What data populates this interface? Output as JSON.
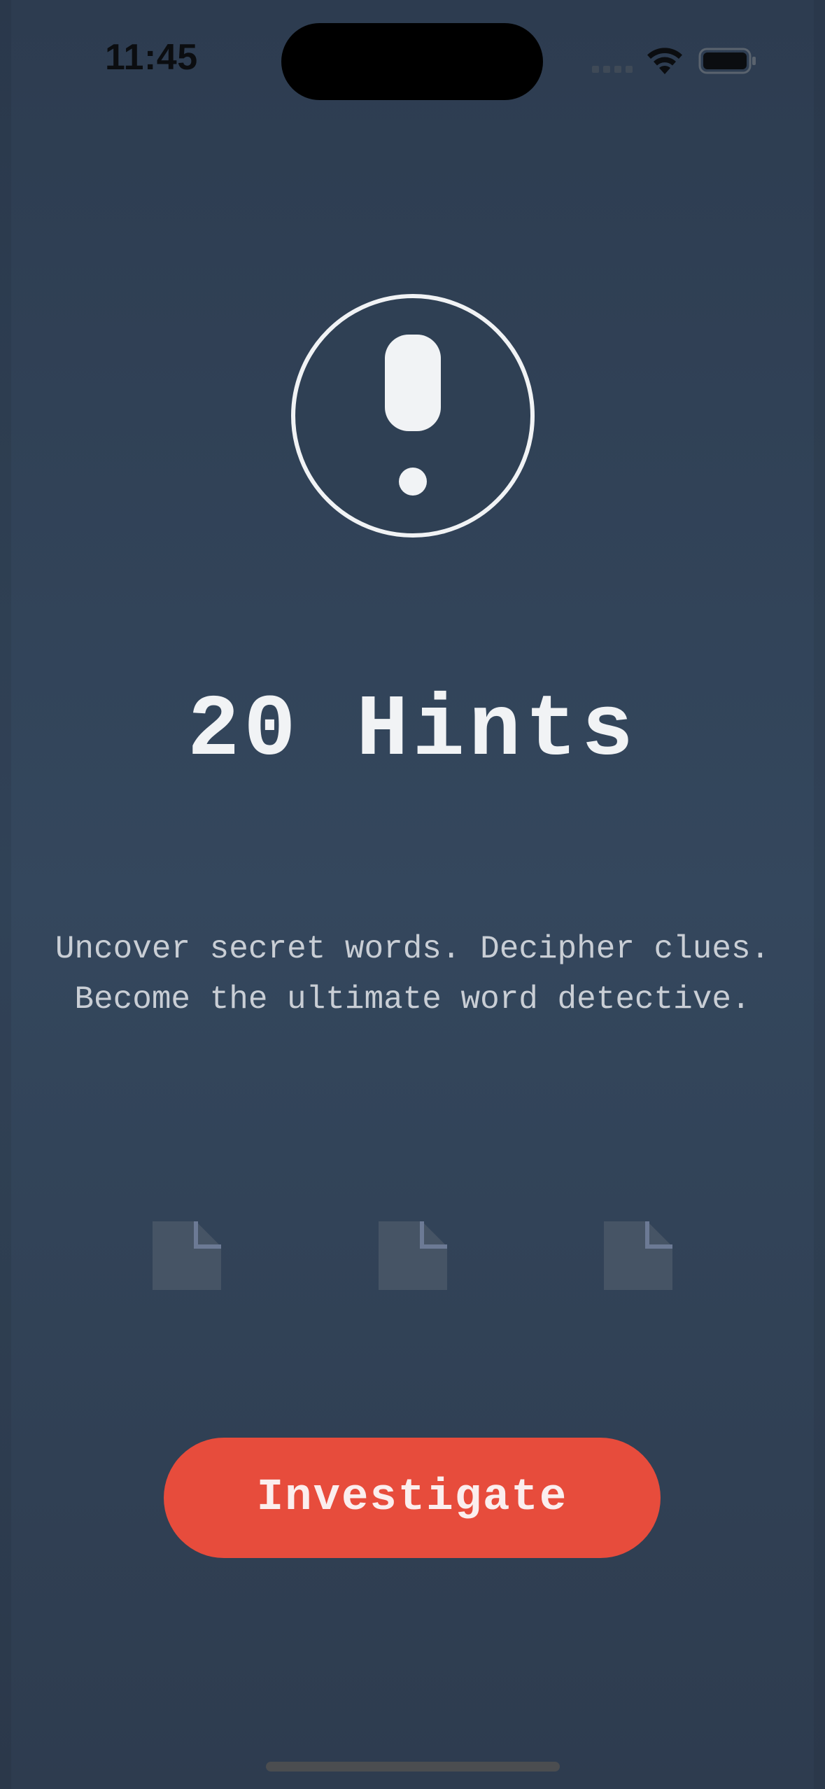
{
  "status_bar": {
    "time": "11:45",
    "icons": [
      "cell-signal-icon",
      "wifi-icon",
      "battery-icon"
    ]
  },
  "hero": {
    "icon": "exclamation-circle-icon",
    "title": "20 Hints",
    "tagline": "Uncover secret words. Decipher clues. Become the ultimate word detective."
  },
  "decorations": {
    "icons": [
      "document-icon",
      "document-icon",
      "document-icon"
    ]
  },
  "cta": {
    "label": "Investigate"
  },
  "colors": {
    "background": "#34475d",
    "accent": "#e74c3c",
    "text_primary": "#f1f3f5",
    "text_secondary": "#c9ced5"
  }
}
